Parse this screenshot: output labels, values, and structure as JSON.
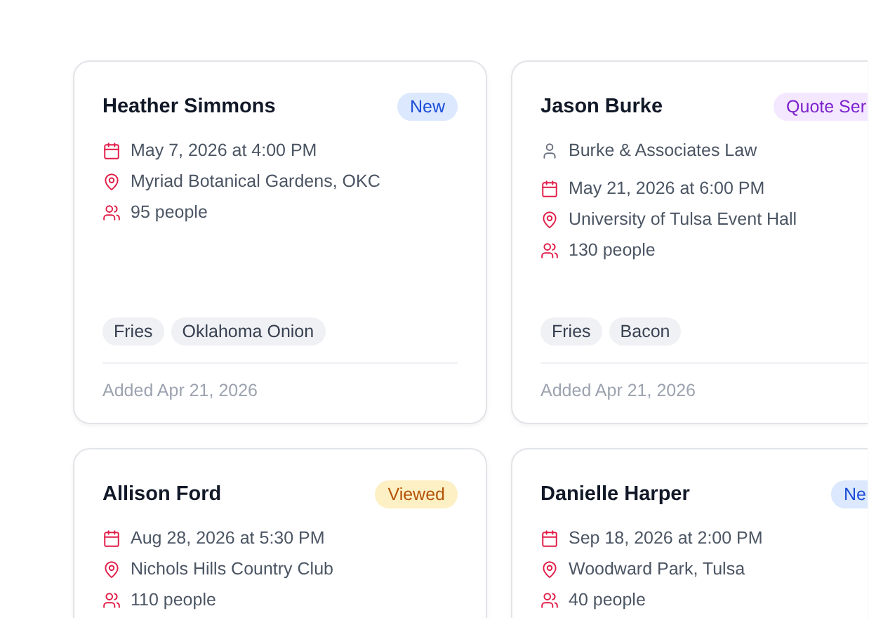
{
  "cards": [
    {
      "name": "Heather Simmons",
      "status": {
        "label": "New",
        "kind": "new"
      },
      "date": "May 7, 2026 at 4:00 PM",
      "location": "Myriad Botanical Gardens, OKC",
      "guests": "95 people",
      "tags": [
        "Fries",
        "Oklahoma Onion"
      ],
      "added": "Added Apr 21, 2026"
    },
    {
      "name": "Jason Burke",
      "status": {
        "label": "Quote Ser",
        "kind": "quote"
      },
      "company": "Burke & Associates Law",
      "date": "May 21, 2026 at 6:00 PM",
      "location": "University of Tulsa Event Hall",
      "guests": "130 people",
      "tags": [
        "Fries",
        "Bacon"
      ],
      "added": "Added Apr 21, 2026"
    },
    {
      "name": "Allison Ford",
      "status": {
        "label": "Viewed",
        "kind": "viewed"
      },
      "date": "Aug 28, 2026 at 5:30 PM",
      "location": "Nichols Hills Country Club",
      "guests": "110 people"
    },
    {
      "name": "Danielle Harper",
      "status": {
        "label": "Ne",
        "kind": "new"
      },
      "date": "Sep 18, 2026 at 2:00 PM",
      "location": "Woodward Park, Tulsa",
      "guests": "40 people"
    }
  ]
}
